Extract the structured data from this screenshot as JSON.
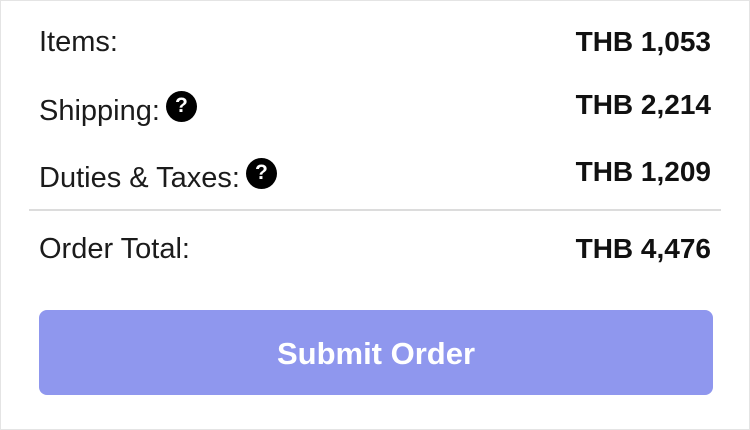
{
  "summary": {
    "items": {
      "label": "Items:",
      "amount": "THB 1,053"
    },
    "shipping": {
      "label": "Shipping:",
      "amount": "THB 2,214",
      "help_glyph": "?",
      "icon": "question-circle-icon"
    },
    "duties": {
      "label": "Duties & Taxes:",
      "amount": "THB 1,209",
      "help_glyph": "?",
      "icon": "question-circle-icon"
    },
    "total": {
      "label": "Order Total:",
      "amount": "THB 4,476"
    }
  },
  "actions": {
    "submit_label": "Submit Order",
    "submit_color": "#8f97ee"
  }
}
